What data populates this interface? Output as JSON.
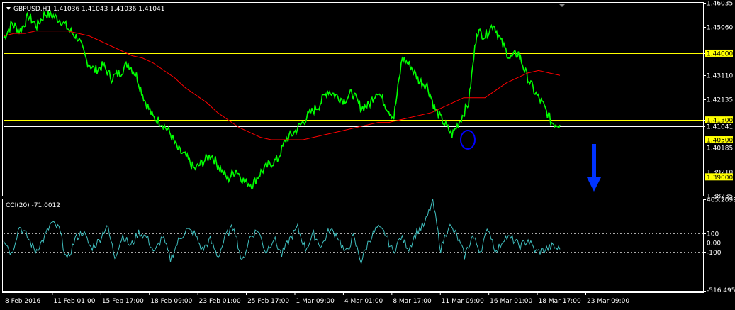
{
  "window": {
    "symbol_line": "GBPUSD,H1  1.41036 1.41043 1.41036 1.41041",
    "indicator_line": "CCI(20) -71.0012"
  },
  "colors": {
    "background": "#000000",
    "price": "#00ff00",
    "ma": "#ff0000",
    "levels": "#ffff00",
    "cci": "#40c0c0",
    "circle": "#0000ff",
    "arrow": "#0033ff",
    "frame": "#ffffff"
  },
  "chart_data": [
    {
      "type": "line",
      "panel": "price",
      "ylim": [
        1.38235,
        1.46035
      ],
      "y_ticks": [
        "1.46035",
        "1.45060",
        "1.44000",
        "1.43110",
        "1.42135",
        "1.41300",
        "1.41041",
        "1.40500",
        "1.40185",
        "1.39210",
        "1.39000",
        "1.38235"
      ],
      "highlight_levels": [
        {
          "value": 1.44,
          "label": "1.44000"
        },
        {
          "value": 1.413,
          "label": "1.41300"
        },
        {
          "value": 1.41041,
          "label": "1.41041"
        },
        {
          "value": 1.405,
          "label": "1.40500"
        },
        {
          "value": 1.39,
          "label": "1.39000"
        }
      ],
      "x_labels": [
        "8 Feb 2016",
        "11 Feb 01:00",
        "15 Feb 17:00",
        "18 Feb 09:00",
        "23 Feb 01:00",
        "25 Feb 17:00",
        "1 Mar 09:00",
        "4 Mar 01:00",
        "8 Mar 17:00",
        "11 Mar 09:00",
        "16 Mar 01:00",
        "18 Mar 17:00",
        "23 Mar 09:00"
      ],
      "series": [
        {
          "role": "price",
          "values": [
            1.446,
            1.452,
            1.449,
            1.455,
            1.451,
            1.456,
            1.455,
            1.453,
            1.449,
            1.446,
            1.437,
            1.433,
            1.435,
            1.43,
            1.432,
            1.436,
            1.431,
            1.421,
            1.414,
            1.412,
            1.408,
            1.401,
            1.398,
            1.393,
            1.396,
            1.399,
            1.394,
            1.389,
            1.393,
            1.388,
            1.387,
            1.392,
            1.395,
            1.397,
            1.405,
            1.408,
            1.412,
            1.416,
            1.419,
            1.425,
            1.423,
            1.421,
            1.424,
            1.418,
            1.419,
            1.425,
            1.419,
            1.414,
            1.438,
            1.435,
            1.429,
            1.427,
            1.417,
            1.412,
            1.407,
            1.413,
            1.42,
            1.449,
            1.447,
            1.452,
            1.444,
            1.438,
            1.44,
            1.431,
            1.424,
            1.419,
            1.412,
            1.411
          ]
        },
        {
          "role": "moving_average",
          "values": [
            1.447,
            1.448,
            1.448,
            1.449,
            1.449,
            1.449,
            1.449,
            1.448,
            1.447,
            1.445,
            1.443,
            1.441,
            1.439,
            1.438,
            1.436,
            1.433,
            1.43,
            1.426,
            1.423,
            1.42,
            1.416,
            1.413,
            1.41,
            1.408,
            1.406,
            1.405,
            1.405,
            1.405,
            1.405,
            1.406,
            1.407,
            1.408,
            1.409,
            1.41,
            1.411,
            1.412,
            1.412,
            1.413,
            1.414,
            1.415,
            1.416,
            1.418,
            1.42,
            1.422,
            1.422,
            1.422,
            1.425,
            1.428,
            1.43,
            1.432,
            1.433,
            1.432,
            1.431
          ]
        }
      ]
    },
    {
      "type": "line",
      "panel": "indicator",
      "name": "CCI(20)",
      "ylim": [
        -516.4956,
        465.2099
      ],
      "y_ticks": [
        "465.2099",
        "100",
        "0.00",
        "-100",
        "-516.4956"
      ],
      "reference_lines": [
        100,
        -100
      ],
      "values": [
        50,
        -120,
        180,
        60,
        -90,
        30,
        210,
        150,
        -200,
        40,
        120,
        -60,
        20,
        190,
        -150,
        80,
        -40,
        110,
        60,
        -110,
        70,
        -180,
        20,
        140,
        100,
        -80,
        30,
        -150,
        80,
        180,
        -220,
        60,
        140,
        -100,
        50,
        -130,
        40,
        160,
        -70,
        90,
        -40,
        140,
        80,
        -120,
        60,
        -200,
        30,
        160,
        100,
        -100,
        60,
        -60,
        120,
        200,
        450,
        -70,
        190,
        80,
        -140,
        70,
        -90,
        160,
        -110,
        60,
        40,
        -40,
        30,
        -100,
        -80,
        -40,
        -71
      ]
    }
  ]
}
